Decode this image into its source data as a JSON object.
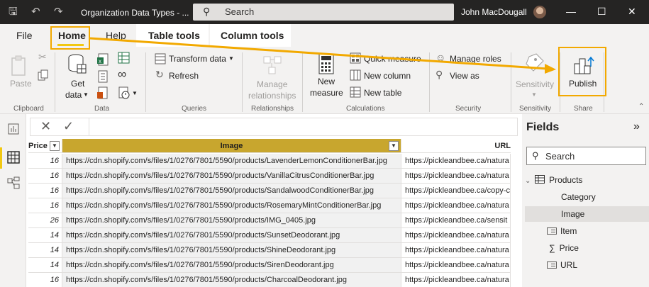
{
  "titlebar": {
    "doc_title": "Organization Data Types - ...",
    "search_placeholder": "Search",
    "user_name": "John MacDougall",
    "icons": [
      "save-icon",
      "undo-icon",
      "redo-icon",
      "minimize-icon",
      "maximize-icon",
      "close-icon"
    ]
  },
  "tabs": {
    "file": "File",
    "home": "Home",
    "help": "Help",
    "table_tools": "Table tools",
    "column_tools": "Column tools"
  },
  "ribbon": {
    "clipboard": {
      "paste": "Paste",
      "group": "Clipboard"
    },
    "data": {
      "get_data": "Get",
      "get_data_2": "data",
      "group": "Data"
    },
    "queries": {
      "transform": "Transform data",
      "refresh": "Refresh",
      "group": "Queries"
    },
    "relationships": {
      "manage": "Manage",
      "manage_2": "relationships",
      "group": "Relationships"
    },
    "calculations": {
      "new_measure": "New",
      "new_measure_2": "measure",
      "quick_measure": "Quick measure",
      "new_column": "New column",
      "new_table": "New table",
      "group": "Calculations"
    },
    "security": {
      "manage_roles": "Manage roles",
      "view_as": "View as",
      "group": "Security"
    },
    "sensitivity": {
      "label": "Sensitivity",
      "group": "Sensitivity"
    },
    "share": {
      "publish": "Publish",
      "group": "Share"
    }
  },
  "grid": {
    "headers": {
      "price": "Price",
      "image": "Image",
      "url": "URL"
    },
    "rows": [
      {
        "price": "16",
        "image": "https://cdn.shopify.com/s/files/1/0276/7801/5590/products/LavenderLemonConditionerBar.jpg",
        "url": "https://pickleandbee.ca/natura"
      },
      {
        "price": "16",
        "image": "https://cdn.shopify.com/s/files/1/0276/7801/5590/products/VanillaCitrusConditionerBar.jpg",
        "url": "https://pickleandbee.ca/natura"
      },
      {
        "price": "16",
        "image": "https://cdn.shopify.com/s/files/1/0276/7801/5590/products/SandalwoodConditionerBar.jpg",
        "url": "https://pickleandbee.ca/copy-c"
      },
      {
        "price": "16",
        "image": "https://cdn.shopify.com/s/files/1/0276/7801/5590/products/RosemaryMintConditionerBar.jpg",
        "url": "https://pickleandbee.ca/natura"
      },
      {
        "price": "26",
        "image": "https://cdn.shopify.com/s/files/1/0276/7801/5590/products/IMG_0405.jpg",
        "url": "https://pickleandbee.ca/sensit"
      },
      {
        "price": "14",
        "image": "https://cdn.shopify.com/s/files/1/0276/7801/5590/products/SunsetDeodorant.jpg",
        "url": "https://pickleandbee.ca/natura"
      },
      {
        "price": "14",
        "image": "https://cdn.shopify.com/s/files/1/0276/7801/5590/products/ShineDeodorant.jpg",
        "url": "https://pickleandbee.ca/natura"
      },
      {
        "price": "14",
        "image": "https://cdn.shopify.com/s/files/1/0276/7801/5590/products/SirenDeodorant.jpg",
        "url": "https://pickleandbee.ca/natura"
      },
      {
        "price": "16",
        "image": "https://cdn.shopify.com/s/files/1/0276/7801/5590/products/CharcoalDeodorant.jpg",
        "url": "https://pickleandbee.ca/natura"
      }
    ]
  },
  "fields": {
    "title": "Fields",
    "search_placeholder": "Search",
    "table": "Products",
    "items": [
      "Category",
      "Image",
      "Item",
      "Price",
      "URL"
    ]
  },
  "colors": {
    "accent": "#f2c811",
    "highlight": "#f2a900",
    "selected_header": "#c8a62e"
  }
}
